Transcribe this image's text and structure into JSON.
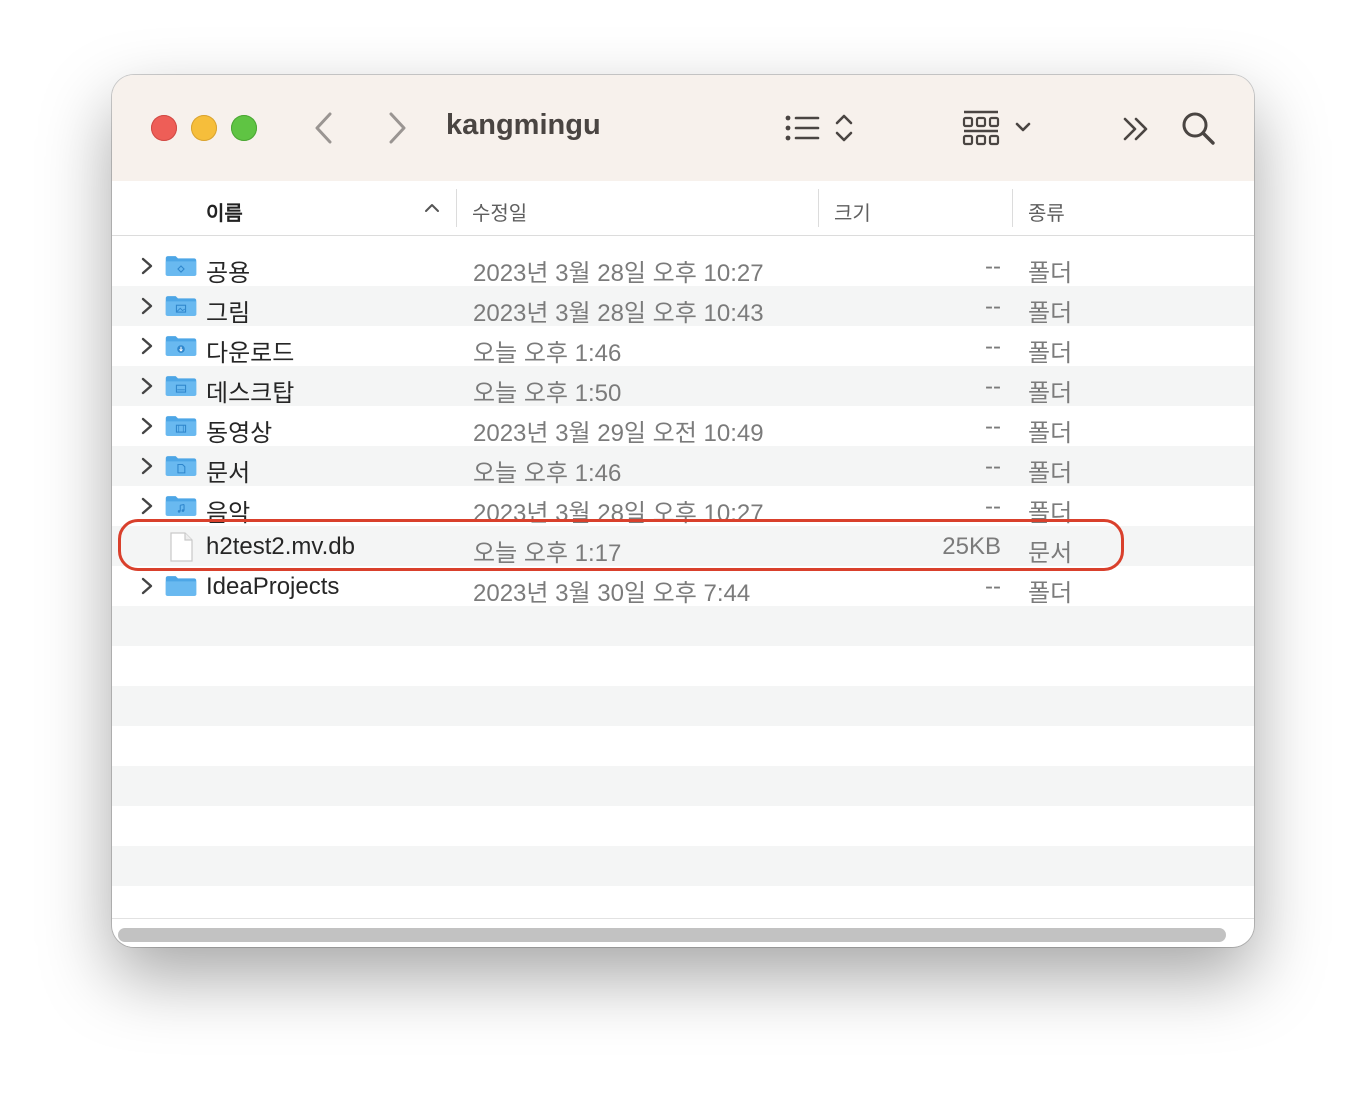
{
  "window": {
    "title": "kangmingu"
  },
  "toolbar": {
    "back_icon": "chevron-left-icon",
    "forward_icon": "chevron-right-icon",
    "view_icon": "list-view-icon",
    "group_icon": "group-grid-icon",
    "more_icon": "double-chevron-right-icon",
    "search_icon": "search-icon"
  },
  "columns": {
    "name": "이름",
    "modified": "수정일",
    "size": "크기",
    "kind": "종류"
  },
  "files": [
    {
      "name": "공용",
      "date": "2023년 3월 28일 오후 10:27",
      "size": "--",
      "kind": "폴더",
      "type": "folder",
      "icon": "public-folder-icon"
    },
    {
      "name": "그림",
      "date": "2023년 3월 28일 오후 10:43",
      "size": "--",
      "kind": "폴더",
      "type": "folder",
      "icon": "pictures-folder-icon"
    },
    {
      "name": "다운로드",
      "date": "오늘 오후 1:46",
      "size": "--",
      "kind": "폴더",
      "type": "folder",
      "icon": "downloads-folder-icon"
    },
    {
      "name": "데스크탑",
      "date": "오늘 오후 1:50",
      "size": "--",
      "kind": "폴더",
      "type": "folder",
      "icon": "desktop-folder-icon"
    },
    {
      "name": "동영상",
      "date": "2023년 3월 29일 오전 10:49",
      "size": "--",
      "kind": "폴더",
      "type": "folder",
      "icon": "movies-folder-icon"
    },
    {
      "name": "문서",
      "date": "오늘 오후 1:46",
      "size": "--",
      "kind": "폴더",
      "type": "folder",
      "icon": "documents-folder-icon"
    },
    {
      "name": "음악",
      "date": "2023년 3월 28일 오후 10:27",
      "size": "--",
      "kind": "폴더",
      "type": "folder",
      "icon": "music-folder-icon"
    },
    {
      "name": "h2test2.mv.db",
      "date": "오늘 오후 1:17",
      "size": "25KB",
      "kind": "문서",
      "type": "file",
      "icon": "document-file-icon"
    },
    {
      "name": "IdeaProjects",
      "date": "2023년 3월 30일 오후 7:44",
      "size": "--",
      "kind": "폴더",
      "type": "folder",
      "icon": "folder-icon"
    }
  ],
  "colors": {
    "highlight": "#d9402c",
    "folder": "#5aaee8",
    "titlebar": "#f7f1ec"
  }
}
